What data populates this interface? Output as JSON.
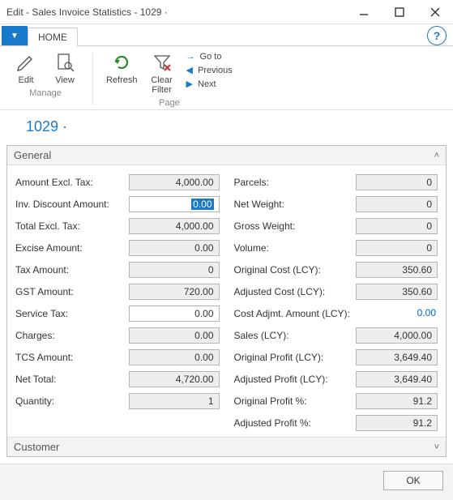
{
  "window": {
    "title": "Edit - Sales Invoice Statistics - 1029 ·"
  },
  "ribbon": {
    "tab_home": "HOME",
    "edit": "Edit",
    "view": "View",
    "refresh": "Refresh",
    "clear_filter": "Clear\nFilter",
    "goto": "Go to",
    "previous": "Previous",
    "next": "Next",
    "group_manage": "Manage",
    "group_page": "Page"
  },
  "record": {
    "number": "1029 ·"
  },
  "panels": {
    "general": "General",
    "customer": "Customer"
  },
  "left": {
    "amount_excl_tax_label": "Amount Excl. Tax:",
    "amount_excl_tax": "4,000.00",
    "inv_discount_label": "Inv. Discount Amount:",
    "inv_discount": "0.00",
    "total_excl_tax_label": "Total Excl. Tax:",
    "total_excl_tax": "4,000.00",
    "excise_label": "Excise Amount:",
    "excise": "0.00",
    "tax_amount_label": "Tax Amount:",
    "tax_amount": "0",
    "gst_label": "GST Amount:",
    "gst": "720.00",
    "service_tax_label": "Service Tax:",
    "service_tax": "0.00",
    "charges_label": "Charges:",
    "charges": "0.00",
    "tcs_label": "TCS Amount:",
    "tcs": "0.00",
    "net_total_label": "Net Total:",
    "net_total": "4,720.00",
    "quantity_label": "Quantity:",
    "quantity": "1"
  },
  "right": {
    "parcels_label": "Parcels:",
    "parcels": "0",
    "net_weight_label": "Net Weight:",
    "net_weight": "0",
    "gross_weight_label": "Gross Weight:",
    "gross_weight": "0",
    "volume_label": "Volume:",
    "volume": "0",
    "orig_cost_label": "Original Cost (LCY):",
    "orig_cost": "350.60",
    "adj_cost_label": "Adjusted Cost (LCY):",
    "adj_cost": "350.60",
    "cost_adjmt_label": "Cost Adjmt. Amount (LCY):",
    "cost_adjmt": "0.00",
    "sales_label": "Sales (LCY):",
    "sales": "4,000.00",
    "orig_profit_label": "Original Profit (LCY):",
    "orig_profit": "3,649.40",
    "adj_profit_label": "Adjusted Profit (LCY):",
    "adj_profit": "3,649.40",
    "orig_profit_pct_label": "Original Profit %:",
    "orig_profit_pct": "91.2",
    "adj_profit_pct_label": "Adjusted Profit %:",
    "adj_profit_pct": "91.2"
  },
  "footer": {
    "ok": "OK"
  }
}
